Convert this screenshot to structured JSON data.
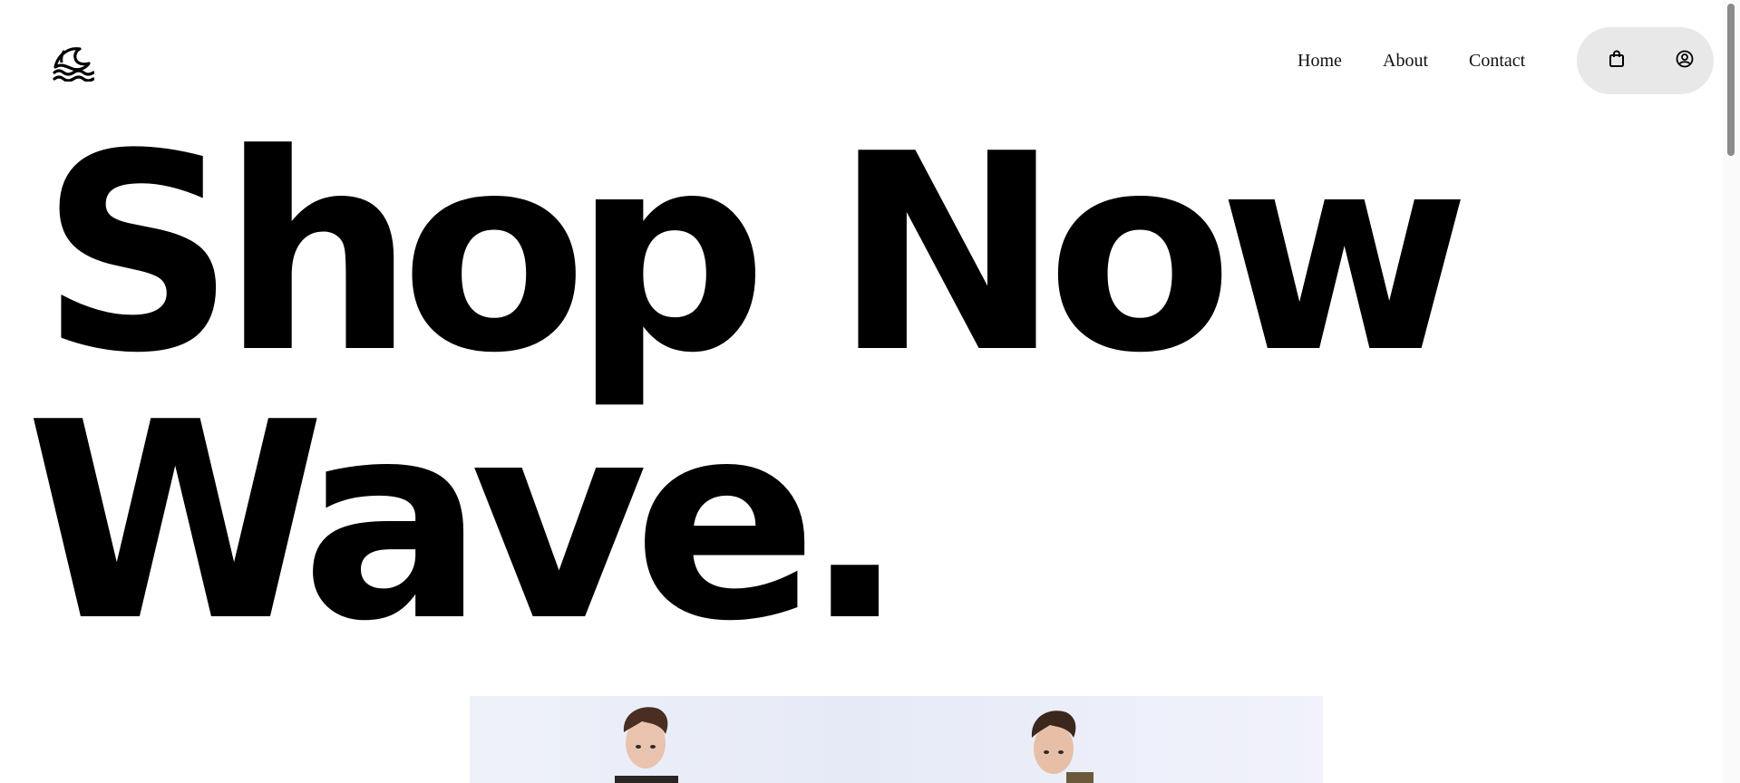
{
  "header": {
    "logo_icon": "wave-logo-icon",
    "nav": {
      "home_label": "Home",
      "about_label": "About",
      "contact_label": "Contact"
    },
    "actions": {
      "cart_icon": "shopping-bag-icon",
      "account_icon": "user-circle-icon",
      "background": "#e8e8e8"
    }
  },
  "hero": {
    "line1": "Shop Now",
    "line2": "Wave."
  },
  "banner": {
    "image": "two-male-models-photo"
  },
  "colors": {
    "text": "#000000",
    "background": "#ffffff",
    "pill": "#e8e8e8"
  }
}
